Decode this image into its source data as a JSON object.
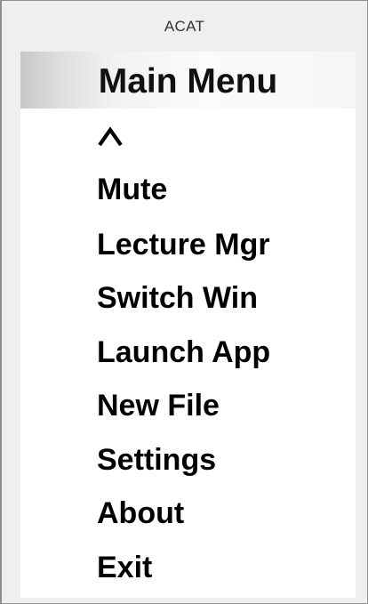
{
  "window": {
    "title": "ACAT"
  },
  "menu": {
    "title": "Main Menu",
    "up_icon": "caret-up-icon",
    "items": [
      {
        "label": "Mute"
      },
      {
        "label": "Lecture Mgr"
      },
      {
        "label": "Switch Win"
      },
      {
        "label": "Launch App"
      },
      {
        "label": "New File"
      },
      {
        "label": "Settings"
      },
      {
        "label": "About"
      },
      {
        "label": "Exit"
      }
    ]
  }
}
